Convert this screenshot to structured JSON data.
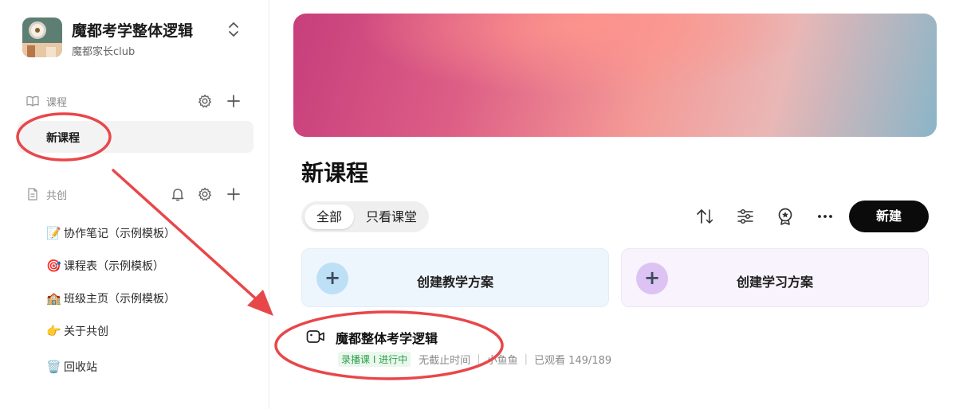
{
  "workspace": {
    "name": "魔都考学整体逻辑",
    "subtitle": "魔都家长club"
  },
  "sidebar": {
    "courses_section": {
      "label": "课程"
    },
    "active_course": "新课程",
    "cocreate_section": {
      "label": "共创"
    },
    "docs": [
      {
        "emoji": "📝",
        "label": "协作笔记（示例模板）"
      },
      {
        "emoji": "🎯",
        "label": "课程表（示例模板）"
      },
      {
        "emoji": "🏫",
        "label": "班级主页（示例模板）"
      },
      {
        "emoji": "👉",
        "label": "关于共创"
      },
      {
        "emoji": "🗑️",
        "label": "回收站"
      }
    ]
  },
  "main": {
    "title": "新课程",
    "filter": {
      "all": "全部",
      "classroom_only": "只看课堂"
    },
    "new_button": "新建",
    "create_cards": [
      {
        "label": "创建教学方案",
        "icon": "+"
      },
      {
        "label": "创建学习方案",
        "icon": "+"
      }
    ],
    "course": {
      "title": "魔都整体考学逻辑",
      "badge": "录播课 I 进行中",
      "deadline": "无截止时间",
      "author": "小鱼鱼",
      "views": "已观看 149/189"
    }
  },
  "icons": {
    "workspace_switch": "chevron-up-down-icon",
    "courses": "book-icon",
    "cocreate": "document-icon",
    "settings": "gear-icon",
    "add": "plus-icon",
    "notify": "bell-icon",
    "sort": "sort-arrows-icon",
    "filter": "sliders-icon",
    "certificate": "badge-icon",
    "more": "ellipsis-icon",
    "video": "video-camera-icon"
  },
  "colors": {
    "accent": "#0b0b0b",
    "annotation": "#e8474a",
    "badge_green": "#2e9e4a"
  }
}
